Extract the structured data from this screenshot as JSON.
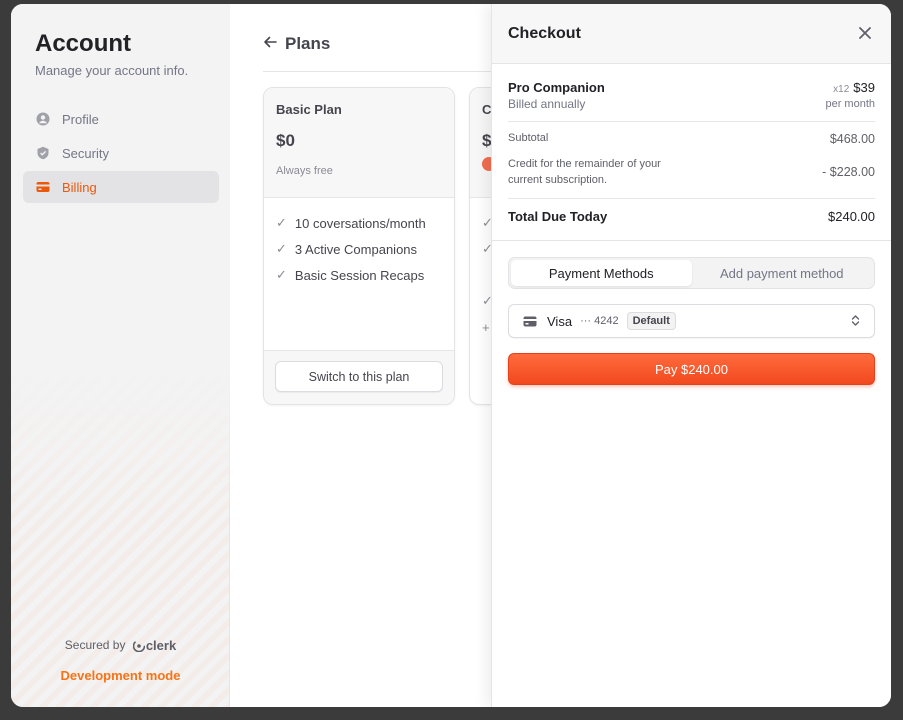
{
  "sidebar": {
    "title": "Account",
    "subtitle": "Manage your account info.",
    "items": [
      {
        "label": "Profile",
        "icon": "user-circle-icon"
      },
      {
        "label": "Security",
        "icon": "shield-icon"
      },
      {
        "label": "Billing",
        "icon": "credit-card-icon",
        "active": true
      }
    ],
    "secured_by": "Secured by",
    "brand": "clerk",
    "dev_mode": "Development mode"
  },
  "main": {
    "back_title": "Plans",
    "plans": [
      {
        "name": "Basic Plan",
        "price": "$0",
        "note": "Always free",
        "features": [
          "10 coversations/month",
          "3 Active Companions",
          "Basic Session Recaps"
        ],
        "button": "Switch to this plan"
      },
      {
        "name": "C",
        "price": "$"
      }
    ]
  },
  "checkout": {
    "title": "Checkout",
    "plan_name": "Pro Companion",
    "billing": "Billed annually",
    "multiplier": "x12",
    "price": "$39",
    "per": "per month",
    "subtotal_label": "Subtotal",
    "subtotal_value": "$468.00",
    "credit_label": "Credit for the remainder of your current subscription.",
    "credit_value": "- $228.00",
    "total_label": "Total Due Today",
    "total_value": "$240.00",
    "tabs": [
      "Payment Methods",
      "Add payment method"
    ],
    "payment_method": {
      "brand": "Visa",
      "last4": "··· 4242",
      "badge": "Default"
    },
    "pay_label": "Pay $240.00"
  },
  "colors": {
    "accent": "#f97316",
    "pay_button": "#f2491f"
  }
}
